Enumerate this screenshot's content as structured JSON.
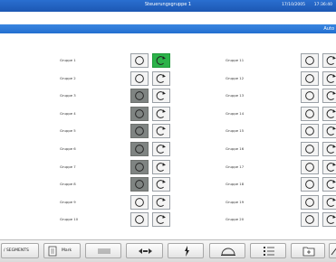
{
  "window": {
    "title": "Steuerungsgruppe 1",
    "date": "17/10/2005",
    "time": "17:36:40"
  },
  "header": {
    "right_text": "Auto"
  },
  "groups_left": [
    {
      "label": "Gruppe 1",
      "state_on": false,
      "action_on": true
    },
    {
      "label": "Gruppe 2",
      "state_on": false,
      "action_on": false
    },
    {
      "label": "Gruppe 3",
      "state_on": true,
      "action_on": false
    },
    {
      "label": "Gruppe 4",
      "state_on": true,
      "action_on": false
    },
    {
      "label": "Gruppe 5",
      "state_on": true,
      "action_on": false
    },
    {
      "label": "Gruppe 6",
      "state_on": true,
      "action_on": false
    },
    {
      "label": "Gruppe 7",
      "state_on": true,
      "action_on": false
    },
    {
      "label": "Gruppe 8",
      "state_on": true,
      "action_on": false
    },
    {
      "label": "Gruppe 9",
      "state_on": false,
      "action_on": false
    },
    {
      "label": "Gruppe 10",
      "state_on": false,
      "action_on": false
    }
  ],
  "groups_right": [
    {
      "label": "Gruppe 11",
      "state_on": false,
      "action_on": false
    },
    {
      "label": "Gruppe 12",
      "state_on": false,
      "action_on": false
    },
    {
      "label": "Gruppe 13",
      "state_on": false,
      "action_on": false
    },
    {
      "label": "Gruppe 14",
      "state_on": false,
      "action_on": false
    },
    {
      "label": "Gruppe 15",
      "state_on": false,
      "action_on": false
    },
    {
      "label": "Gruppe 16",
      "state_on": false,
      "action_on": false
    },
    {
      "label": "Gruppe 17",
      "state_on": false,
      "action_on": false
    },
    {
      "label": "Gruppe 18",
      "state_on": false,
      "action_on": false
    },
    {
      "label": "Gruppe 19",
      "state_on": false,
      "action_on": false
    },
    {
      "label": "Gruppe 20",
      "state_on": false,
      "action_on": false
    }
  ],
  "toolbar": {
    "back_label": "/ SEGMENTS",
    "main_label": "Mark",
    "colors": {
      "titlebar": "#1d57b3",
      "header": "#236fd0",
      "state_on": "#7f8482",
      "action_on": "#2cb34a"
    }
  }
}
